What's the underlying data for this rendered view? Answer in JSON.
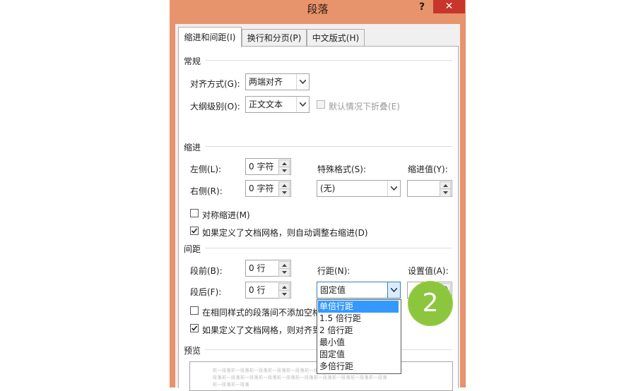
{
  "dialog": {
    "title": "段落",
    "help": "?",
    "close": "✕"
  },
  "tabs": [
    {
      "label": "缩进和间距(I)",
      "active": true
    },
    {
      "label": "换行和分页(P)",
      "active": false
    },
    {
      "label": "中文版式(H)",
      "active": false
    }
  ],
  "general": {
    "heading": "常规",
    "alignment_label": "对齐方式(G):",
    "alignment_value": "两端对齐",
    "outline_label": "大纲级别(O):",
    "outline_value": "正文文本",
    "collapse_label": "默认情况下折叠(E)"
  },
  "indent": {
    "heading": "缩进",
    "left_label": "左侧(L):",
    "left_value": "0 字符",
    "right_label": "右侧(R):",
    "right_value": "0 字符",
    "special_label": "特殊格式(S):",
    "special_value": "(无)",
    "by_label": "缩进值(Y):",
    "mirror_label": "对称缩进(M)",
    "auto_adjust_label": "如果定义了文档网格，则自动调整右缩进(D)"
  },
  "spacing": {
    "heading": "间距",
    "before_label": "段前(B):",
    "before_value": "0 行",
    "after_label": "段后(F):",
    "after_value": "0 行",
    "line_label": "行距(N):",
    "line_value": "固定值",
    "at_label": "设置值(A):",
    "no_space_label": "在相同样式的段落间不添加空格",
    "snap_grid_label": "如果定义了文档网格，则对齐到"
  },
  "line_spacing_options": [
    "单倍行距",
    "1.5 倍行距",
    "2 倍行距",
    "最小值",
    "固定值",
    "多倍行距"
  ],
  "preview": {
    "heading": "预览",
    "line1": "前一段落前一段落前一段落前一段落前一段落前一段落前一段落前一段落前一段落前一",
    "line2": "段落前一段落前一段落前一段落前一段落前一段落前一段落前一段落前一段落前一段落",
    "line3": "前一段落前一段落"
  },
  "step_badge": "2",
  "colors": {
    "title_bar": "#e7936c",
    "close": "#c7352b",
    "highlight": "#3399ff",
    "badge": "#8cc63f"
  }
}
